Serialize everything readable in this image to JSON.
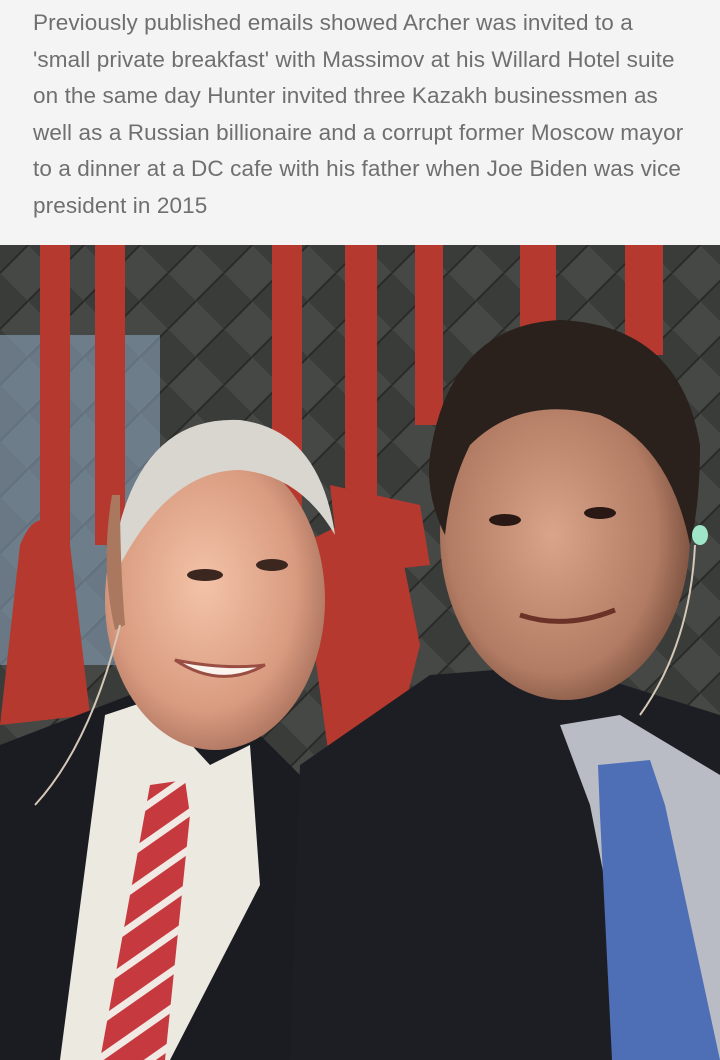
{
  "caption": {
    "text": "Previously published emails showed Archer was invited to a 'small private breakfast' with Massimov at his Willard Hotel suite on the same day Hunter invited three Kazakh businessmen as well as a Russian billionaire and a corrupt former Moscow mayor to a dinner at a DC cafe with his father when Joe Biden was vice president in 2015"
  },
  "photo": {
    "subject": "selfie-of-two-men",
    "colors": {
      "background": "#2d2e2c",
      "curtain": "#b5392e",
      "left_tie": "#c63a3f",
      "right_tie": "#4e6fb5",
      "suit": "#1c1c20"
    }
  }
}
